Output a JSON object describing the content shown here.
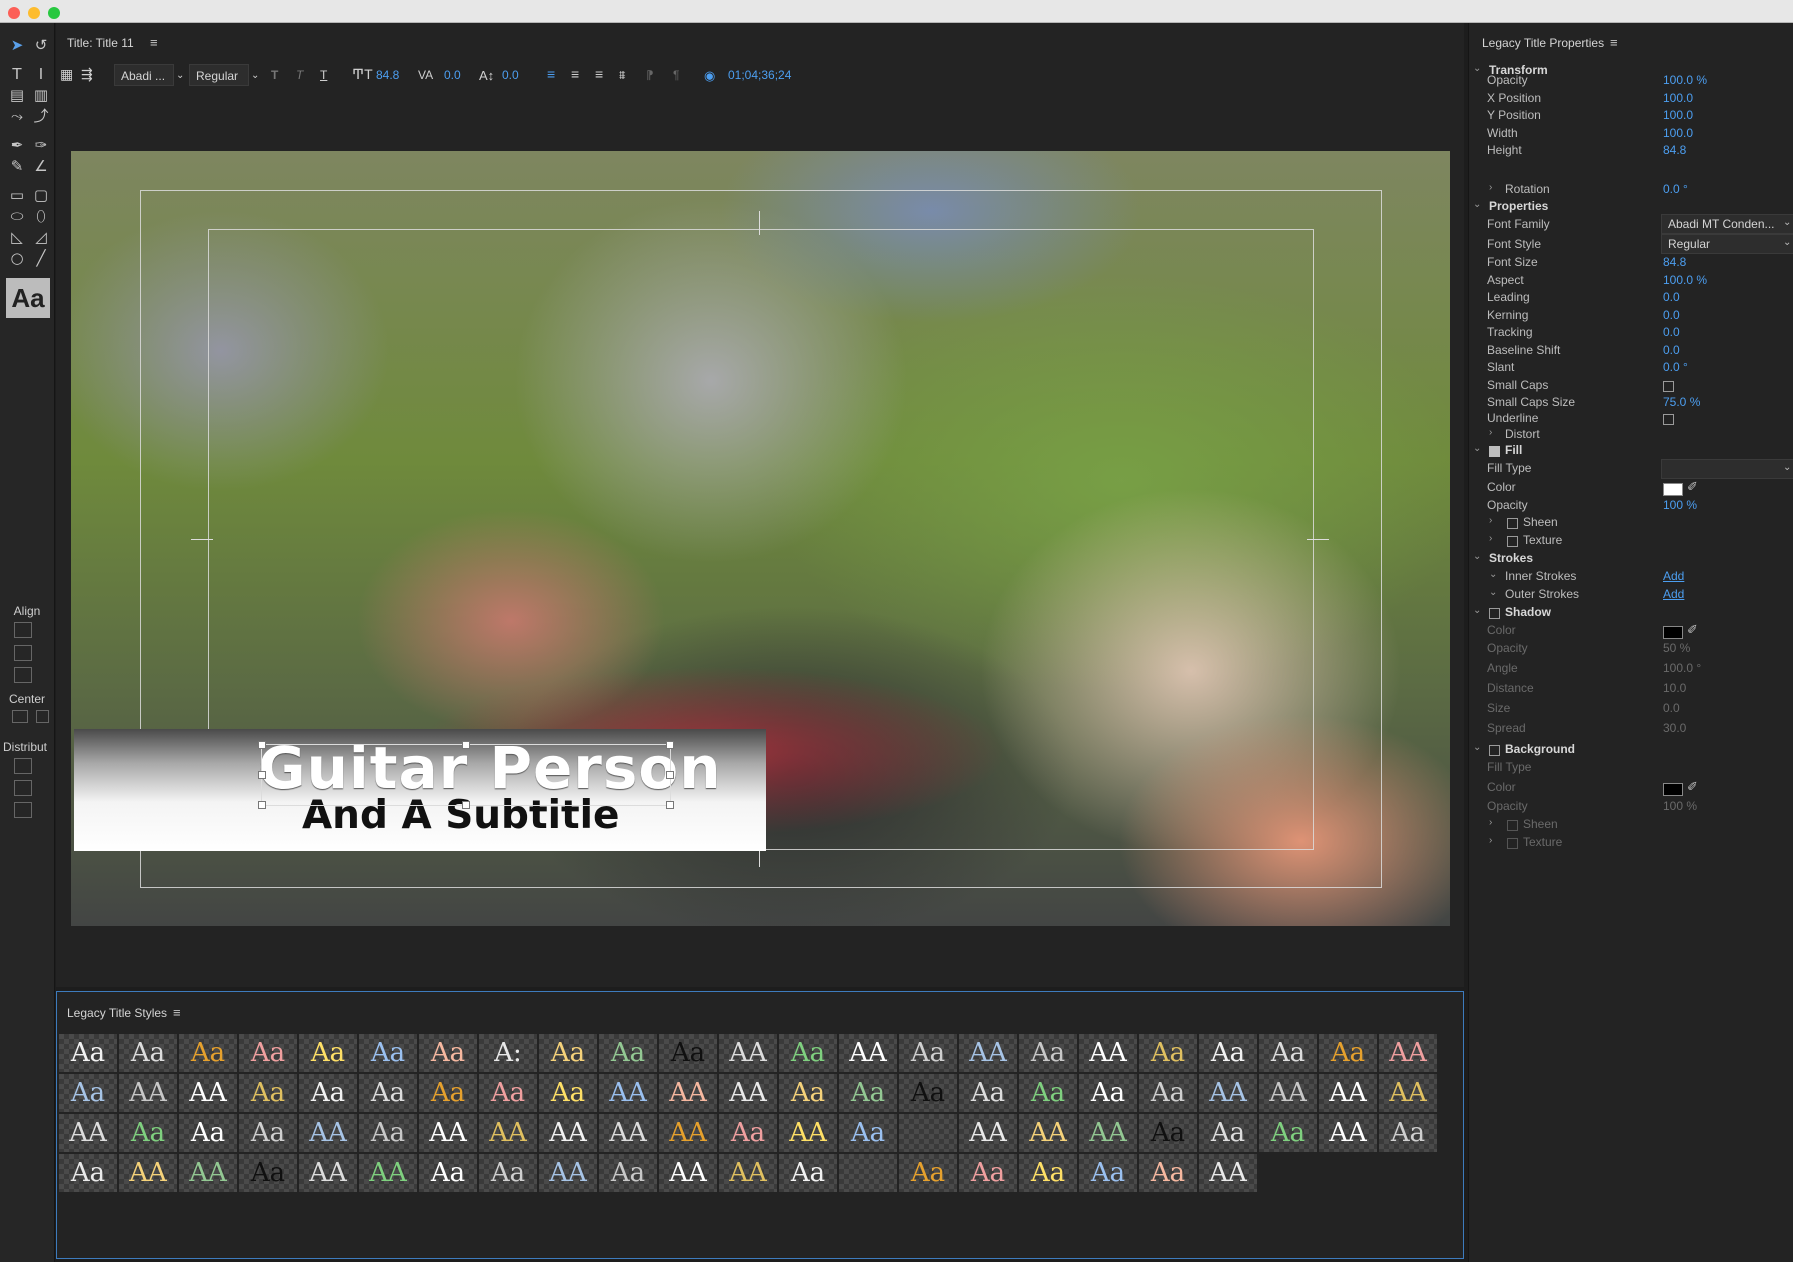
{
  "title_panel": {
    "header": "Title: Title 11",
    "font_family": "Abadi ...",
    "font_style": "Regular",
    "font_size": "84.8",
    "kerning": "0.0",
    "leading": "0.0",
    "timecode": "01;04;36;24"
  },
  "canvas": {
    "main_title": "Guitar Person",
    "subtitle": "And A Subtitle"
  },
  "side": {
    "style_preview": "Aa",
    "align_label": "Align",
    "center_label": "Center",
    "distribute_label": "Distribut"
  },
  "styles_panel": {
    "header": "Legacy Title Styles",
    "rows": [
      [
        "Aa",
        "Aa",
        "Aa",
        "Aa",
        "Aa",
        "Aa",
        "Aa",
        "A:",
        "Aa",
        "Aa",
        "Aa",
        "AA",
        "Aa",
        "AA",
        "Aa",
        "AA",
        "Aa",
        "AA",
        "Aa",
        "Aa",
        "Aa",
        "Aa",
        "AA"
      ],
      [
        "Aa",
        "AA",
        "AA",
        "Aa",
        "Aa",
        "Aa",
        "Aa",
        "Aa",
        "Aa",
        "AA",
        "AA",
        "AA",
        "Aa",
        "Aa",
        "Aa",
        "Aa",
        "Aa",
        "Aa",
        "Aa",
        "AA",
        "AA",
        "AA",
        "AA"
      ],
      [
        "AA",
        "Aa",
        "Aa",
        "Aa",
        "AA",
        "Aa",
        "AA",
        "AA",
        "AA",
        "AA",
        "AA",
        "Aa",
        "AA",
        "Aa",
        "",
        "AA",
        "AA",
        "AA",
        "Aa",
        "Aa",
        "Aa",
        "AA",
        "Aa"
      ],
      [
        "Aa",
        "AA",
        "AA",
        "Aa",
        "AA",
        "AA",
        "Aa",
        "Aa",
        "AA",
        "Aa",
        "AA",
        "AA",
        "Aa",
        "",
        "Aa",
        "Aa",
        "Aa",
        "Aa",
        "Aa",
        "AA"
      ]
    ]
  },
  "props": {
    "header": "Legacy Title Properties",
    "transform": {
      "label": "Transform",
      "rows": [
        {
          "label": "Opacity",
          "value": "100.0 %"
        },
        {
          "label": "X Position",
          "value": "100.0"
        },
        {
          "label": "Y Position",
          "value": "100.0"
        },
        {
          "label": "Width",
          "value": "100.0"
        },
        {
          "label": "Height",
          "value": "84.8"
        }
      ],
      "rotation_label": "Rotation",
      "rotation_value": "0.0 °"
    },
    "properties": {
      "label": "Properties",
      "font_family_label": "Font Family",
      "font_family_value": "Abadi MT Conden...",
      "font_style_label": "Font Style",
      "font_style_value": "Regular",
      "rows": [
        {
          "label": "Font Size",
          "value": "84.8"
        },
        {
          "label": "Aspect",
          "value": "100.0 %"
        },
        {
          "label": "Leading",
          "value": "0.0"
        },
        {
          "label": "Kerning",
          "value": "0.0"
        },
        {
          "label": "Tracking",
          "value": "0.0"
        },
        {
          "label": "Baseline Shift",
          "value": "0.0"
        },
        {
          "label": "Slant",
          "value": "0.0 °"
        }
      ],
      "small_caps_label": "Small Caps",
      "small_caps_checked": false,
      "small_caps_size_label": "Small Caps Size",
      "small_caps_size_value": "75.0 %",
      "underline_label": "Underline",
      "underline_checked": false,
      "distort_label": "Distort"
    },
    "fill": {
      "label": "Fill",
      "checked": true,
      "fill_type_label": "Fill Type",
      "color_label": "Color",
      "color_value": "#ffffff",
      "opacity_label": "Opacity",
      "opacity_value": "100 %",
      "sheen_label": "Sheen",
      "texture_label": "Texture"
    },
    "strokes": {
      "label": "Strokes",
      "inner_label": "Inner Strokes",
      "outer_label": "Outer Strokes",
      "add_label": "Add"
    },
    "shadow": {
      "label": "Shadow",
      "checked": false,
      "color_label": "Color",
      "color_value": "#000000",
      "rows": [
        {
          "label": "Opacity",
          "value": "50 %"
        },
        {
          "label": "Angle",
          "value": "100.0 °"
        },
        {
          "label": "Distance",
          "value": "10.0"
        },
        {
          "label": "Size",
          "value": "0.0"
        },
        {
          "label": "Spread",
          "value": "30.0"
        }
      ]
    },
    "background": {
      "label": "Background",
      "checked": false,
      "fill_type_label": "Fill Type",
      "color_label": "Color",
      "color_value": "#000000",
      "opacity_label": "Opacity",
      "opacity_value": "100 %",
      "sheen_label": "Sheen",
      "texture_label": "Texture"
    }
  },
  "colors": {
    "accent": "#4c9ef0",
    "panel_bg": "#232323",
    "selection_border": "#3d7bbd"
  }
}
